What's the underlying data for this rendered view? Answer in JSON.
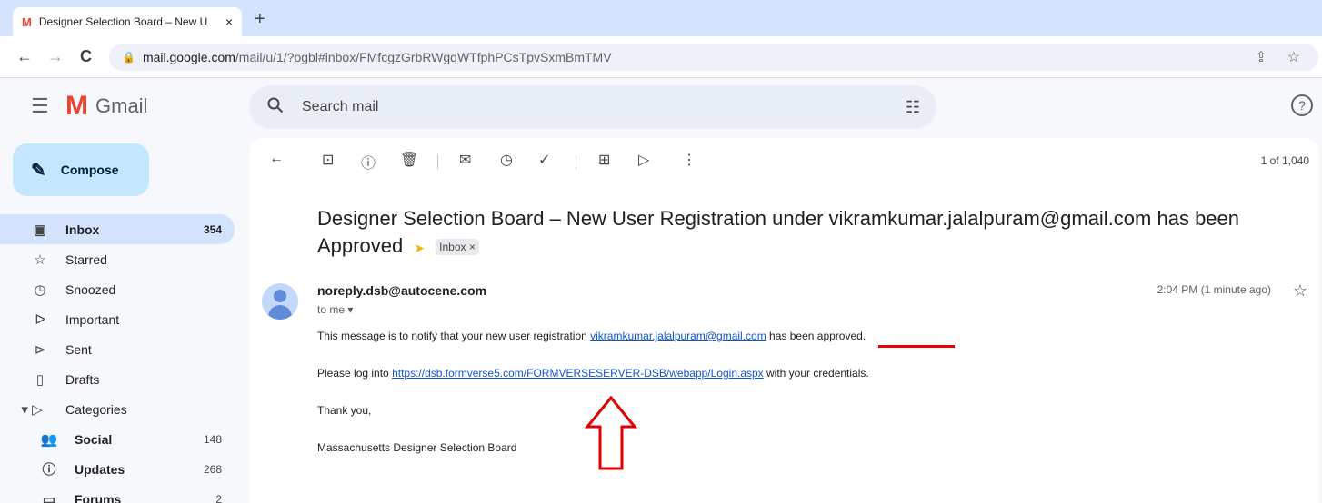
{
  "browser": {
    "tab_title": "Designer Selection Board – New U",
    "tab_favicon": "M",
    "tab_close": "×",
    "new_tab": "+",
    "back": "←",
    "forward": "→",
    "reload": "C",
    "url_host": "mail.google.com",
    "url_rest": "/mail/u/1/?ogbl#inbox/FMfcgzGrbRWgqWTfphPCsTpvSxmBmTMV"
  },
  "gmail": {
    "app_name": "Gmail",
    "logo_mark": "M",
    "search_placeholder": "Search mail"
  },
  "sidebar": {
    "compose_label": "Compose",
    "items": [
      {
        "label": "Inbox",
        "count": "354",
        "icon": "inbox-icon",
        "glyph": "▣"
      },
      {
        "label": "Starred",
        "count": "",
        "icon": "star-icon",
        "glyph": "☆"
      },
      {
        "label": "Snoozed",
        "count": "",
        "icon": "clock-icon",
        "glyph": "◷"
      },
      {
        "label": "Important",
        "count": "",
        "icon": "important-icon",
        "glyph": "ᐅ"
      },
      {
        "label": "Sent",
        "count": "",
        "icon": "send-icon",
        "glyph": "⊳"
      },
      {
        "label": "Drafts",
        "count": "",
        "icon": "draft-icon",
        "glyph": "▯"
      },
      {
        "label": "Categories",
        "count": "",
        "icon": "label-icon",
        "glyph": "▾ ▷"
      },
      {
        "label": "Social",
        "count": "148",
        "icon": "people-icon",
        "glyph": "👥"
      },
      {
        "label": "Updates",
        "count": "268",
        "icon": "info-icon",
        "glyph": "ⓘ"
      },
      {
        "label": "Forums",
        "count": "2",
        "icon": "forum-icon",
        "glyph": "▭"
      }
    ]
  },
  "message": {
    "pager": "1 of 1,040",
    "subject": "Designer Selection Board – New User Registration under vikramkumar.jalalpuram@gmail.com has been Approved",
    "label_chip": "Inbox ×",
    "sender": "noreply.dsb@autocene.com",
    "to": "to me ▾",
    "time": "2:04 PM (1 minute ago)",
    "line1_pre": "This message is to notify that your new user registration ",
    "line1_link": "vikramkumar.jalalpuram@gmail.com",
    "line1_post": "  has been approved.",
    "line2_pre": "Please log into ",
    "line2_link": "https://dsb.formverse5.com/FORMVERSESERVER-DSB/webapp/Login.aspx",
    "line2_post": " with your credentials.",
    "line3": "Thank you,",
    "line4": "Massachusetts Designer Selection Board"
  },
  "colors": {
    "annotation": "#e00000",
    "link": "#1155cc",
    "compose_bg": "#c2e7ff",
    "active_bg": "#d3e3fd"
  }
}
